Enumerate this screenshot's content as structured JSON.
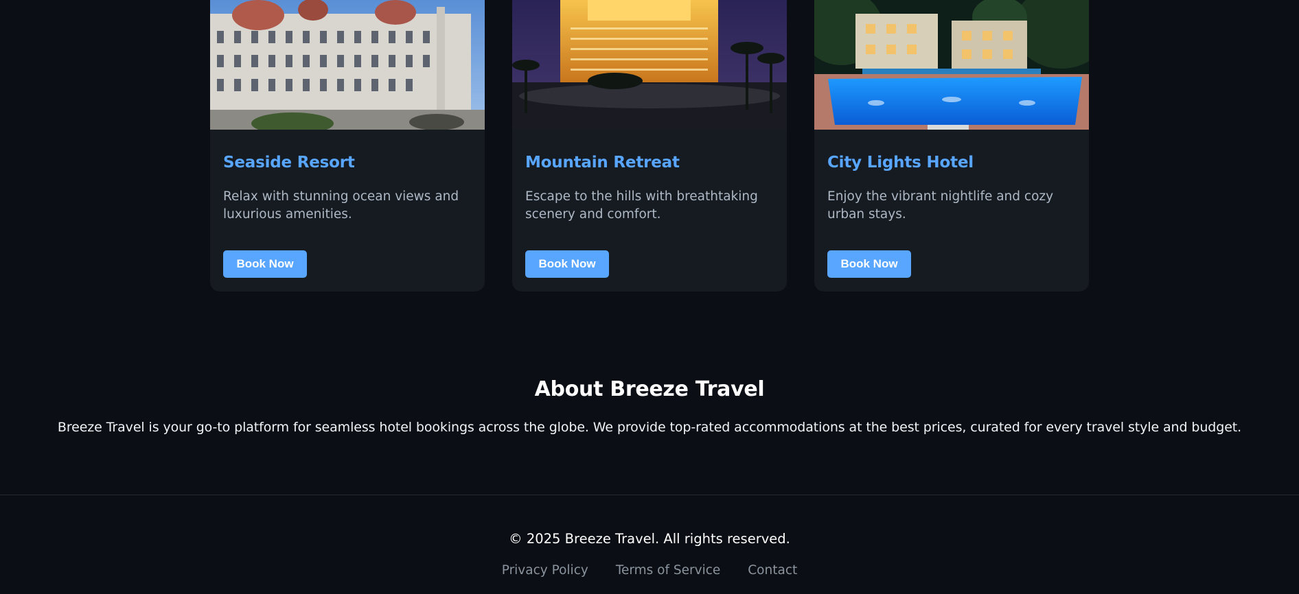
{
  "hotels": [
    {
      "title": "Seaside Resort",
      "description": "Relax with stunning ocean views and luxurious amenities.",
      "button_label": "Book Now",
      "image_label": "Historic white palace hotel under a blue sky"
    },
    {
      "title": "Mountain Retreat",
      "description": "Escape to the hills with breathtaking scenery and comfort.",
      "button_label": "Book Now",
      "image_label": "Golden illuminated hotel tower at night"
    },
    {
      "title": "City Lights Hotel",
      "description": "Enjoy the vibrant nightlife and cozy urban stays.",
      "button_label": "Book Now",
      "image_label": "Lit blue pool with loungers in front of a resort at night"
    }
  ],
  "about": {
    "heading": "About Breeze Travel",
    "text": "Breeze Travel is your go-to platform for seamless hotel bookings across the globe. We provide top-rated accommodations at the best prices, curated for every travel style and budget."
  },
  "footer": {
    "copyright": "© 2025 Breeze Travel. All rights reserved.",
    "links": [
      "Privacy Policy",
      "Terms of Service",
      "Contact"
    ]
  },
  "colors": {
    "background": "#0b0e14",
    "card": "#161b22",
    "accent": "#58a6ff",
    "muted_text": "#8b949e"
  }
}
